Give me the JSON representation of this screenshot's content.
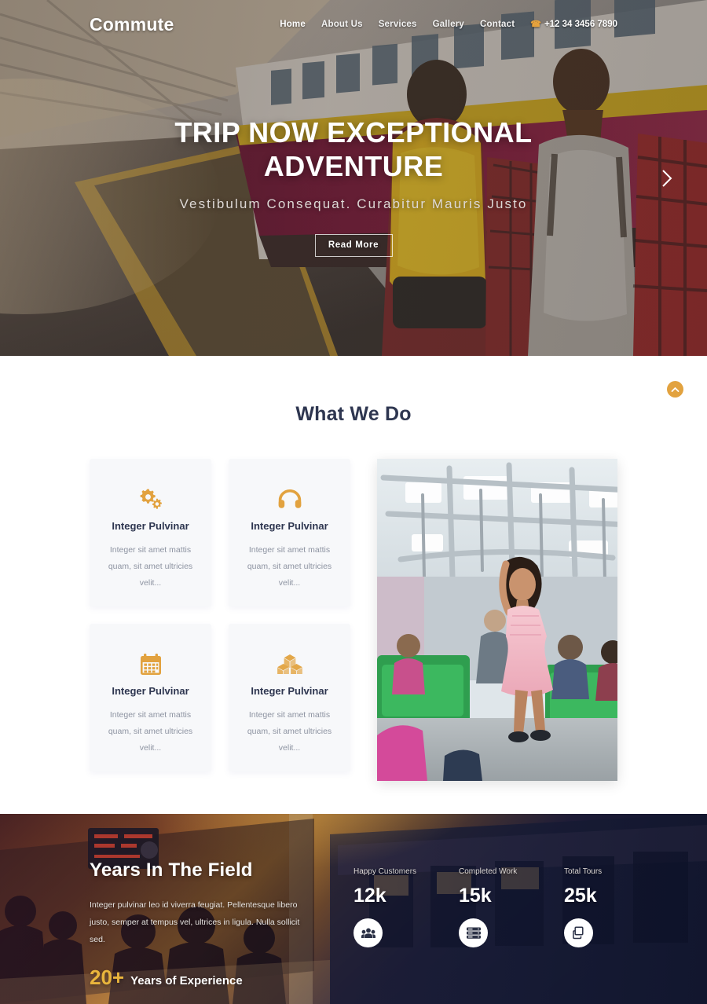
{
  "site": {
    "logo": "Commute",
    "accent_color": "#e2a23f",
    "dark_color": "#2e3650"
  },
  "nav": {
    "items": [
      {
        "label": "Home",
        "active": true
      },
      {
        "label": "About Us",
        "active": false
      },
      {
        "label": "Services",
        "active": false
      },
      {
        "label": "Gallery",
        "active": false
      },
      {
        "label": "Contact",
        "active": false
      }
    ],
    "phone": "+12 34 3456 7890",
    "phone_icon": "phone-icon"
  },
  "hero": {
    "title": "TRIP NOW EXCEPTIONAL ADVENTURE",
    "subtitle": "Vestibulum Consequat. Curabitur Mauris Justo",
    "button_label": "Read More",
    "next_arrow": "chevron-right-icon"
  },
  "services": {
    "heading": "What We Do",
    "scroll_top_icon": "chevron-up-icon",
    "cards": [
      {
        "icon": "gears-icon",
        "title": "Integer Pulvinar",
        "text": "Integer sit amet mattis quam, sit amet ultricies velit..."
      },
      {
        "icon": "headphones-icon",
        "title": "Integer Pulvinar",
        "text": "Integer sit amet mattis quam, sit amet ultricies velit..."
      },
      {
        "icon": "calendar-icon",
        "title": "Integer Pulvinar",
        "text": "Integer sit amet mattis quam, sit amet ultricies velit..."
      },
      {
        "icon": "boxes-icon",
        "title": "Integer Pulvinar",
        "text": "Integer sit amet mattis quam, sit amet ultricies velit..."
      }
    ],
    "photo_alt": "woman-standing-in-subway-train-car"
  },
  "stats": {
    "heading": "Years In The Field",
    "paragraph": "Integer pulvinar leo id viverra feugiat. Pellentesque libero justo, semper at tempus vel, ultrices in ligula. Nulla sollicit sed.",
    "experience_number": "20+",
    "experience_label": "Years of Experience",
    "counters": [
      {
        "label": "Happy Customers",
        "value": "12k",
        "icon": "users-group-icon"
      },
      {
        "label": "Completed Work",
        "value": "15k",
        "icon": "server-list-icon"
      },
      {
        "label": "Total Tours",
        "value": "25k",
        "icon": "copy-layers-icon"
      }
    ],
    "photo_alt": "train-platform-at-sunset"
  }
}
